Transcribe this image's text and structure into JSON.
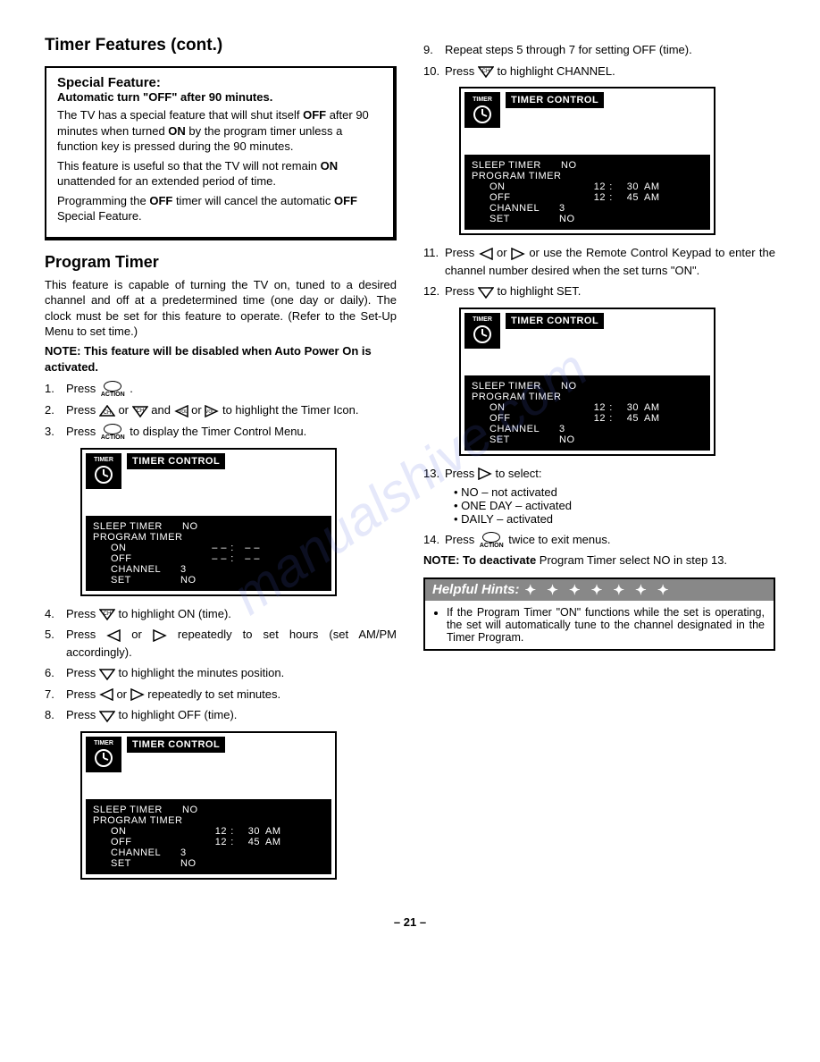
{
  "page_title": "Timer Features (cont.)",
  "special": {
    "title": "Special Feature:",
    "subtitle": "Automatic turn \"OFF\" after 90 minutes.",
    "p1a": "The TV has a special feature that will shut itself ",
    "p1b": "OFF",
    "p1c": " after 90 minutes when turned ",
    "p1d": "ON",
    "p1e": " by the program timer unless a function key is pressed during the 90 minutes.",
    "p2a": "This feature is useful so that the TV will not remain ",
    "p2b": "ON",
    "p2c": " unattended for an extended period of time.",
    "p3a": "Programming the ",
    "p3b": "OFF",
    "p3c": " timer will cancel the automatic ",
    "p3d": "OFF",
    "p3e": " Special Feature."
  },
  "program_timer": {
    "heading": "Program Timer",
    "desc": "This feature is capable of turning the TV on, tuned to a desired channel and off at a predetermined time (one day or daily). The clock must be set for this feature to operate. (Refer to the Set-Up Menu to set time.)",
    "note": "NOTE: This feature will be disabled when Auto Power On is activated."
  },
  "action_label": "ACTION",
  "left_steps": {
    "s1a": "Press ",
    "s1b": " .",
    "s2a": "Press ",
    "s2b": " or ",
    "s2c": " and ",
    "s2d": " or ",
    "s2e": " to highlight the Timer Icon.",
    "s3a": "Press ",
    "s3b": " to display the Timer Control Menu.",
    "s4a": "Press ",
    "s4b": " to highlight ON (time).",
    "s5a": "Press ",
    "s5b": " or ",
    "s5c": " repeatedly to set hours (set AM/PM accordingly).",
    "s6a": "Press ",
    "s6b": " to highlight the minutes position.",
    "s7a": "Press ",
    "s7b": " or ",
    "s7c": " repeatedly to set minutes.",
    "s8a": "Press ",
    "s8b": " to highlight OFF (time)."
  },
  "right_steps": {
    "s9": "Repeat steps 5 through 7 for setting OFF (time).",
    "s10a": "Press ",
    "s10b": " to highlight CHANNEL.",
    "s11a": "Press ",
    "s11b": " or ",
    "s11c": " or use the Remote Control Keypad to enter the channel number desired when the set turns \"ON\".",
    "s12a": "Press ",
    "s12b": " to highlight SET.",
    "s13a": "Press ",
    "s13b": " to select:",
    "opt1": "NO – not activated",
    "opt2": "ONE DAY – activated",
    "opt3": "DAILY – activated",
    "s14a": "Press ",
    "s14b": " twice to exit menus.",
    "note2a": "NOTE: To deactivate",
    "note2b": " Program Timer select NO in step 13."
  },
  "hints": {
    "title": "Helpful Hints:",
    "body": "If the Program Timer \"ON\" functions while the set is operating, the set will automatically tune to the channel designated in the Timer Program."
  },
  "osd": {
    "timer_label": "TIMER",
    "control": "TIMER CONTROL",
    "sleep": "SLEEP TIMER",
    "no": "NO",
    "prog": "PROGRAM TIMER",
    "on": "ON",
    "off": "OFF",
    "channel": "CHANNEL",
    "set": "SET",
    "dash": "– –",
    "colon": ":",
    "ch_val": "3",
    "h12": "12",
    "m30": "30",
    "m45": "45",
    "am": "AM"
  },
  "page_number": "– 21 –",
  "watermark": "manualshive.com"
}
